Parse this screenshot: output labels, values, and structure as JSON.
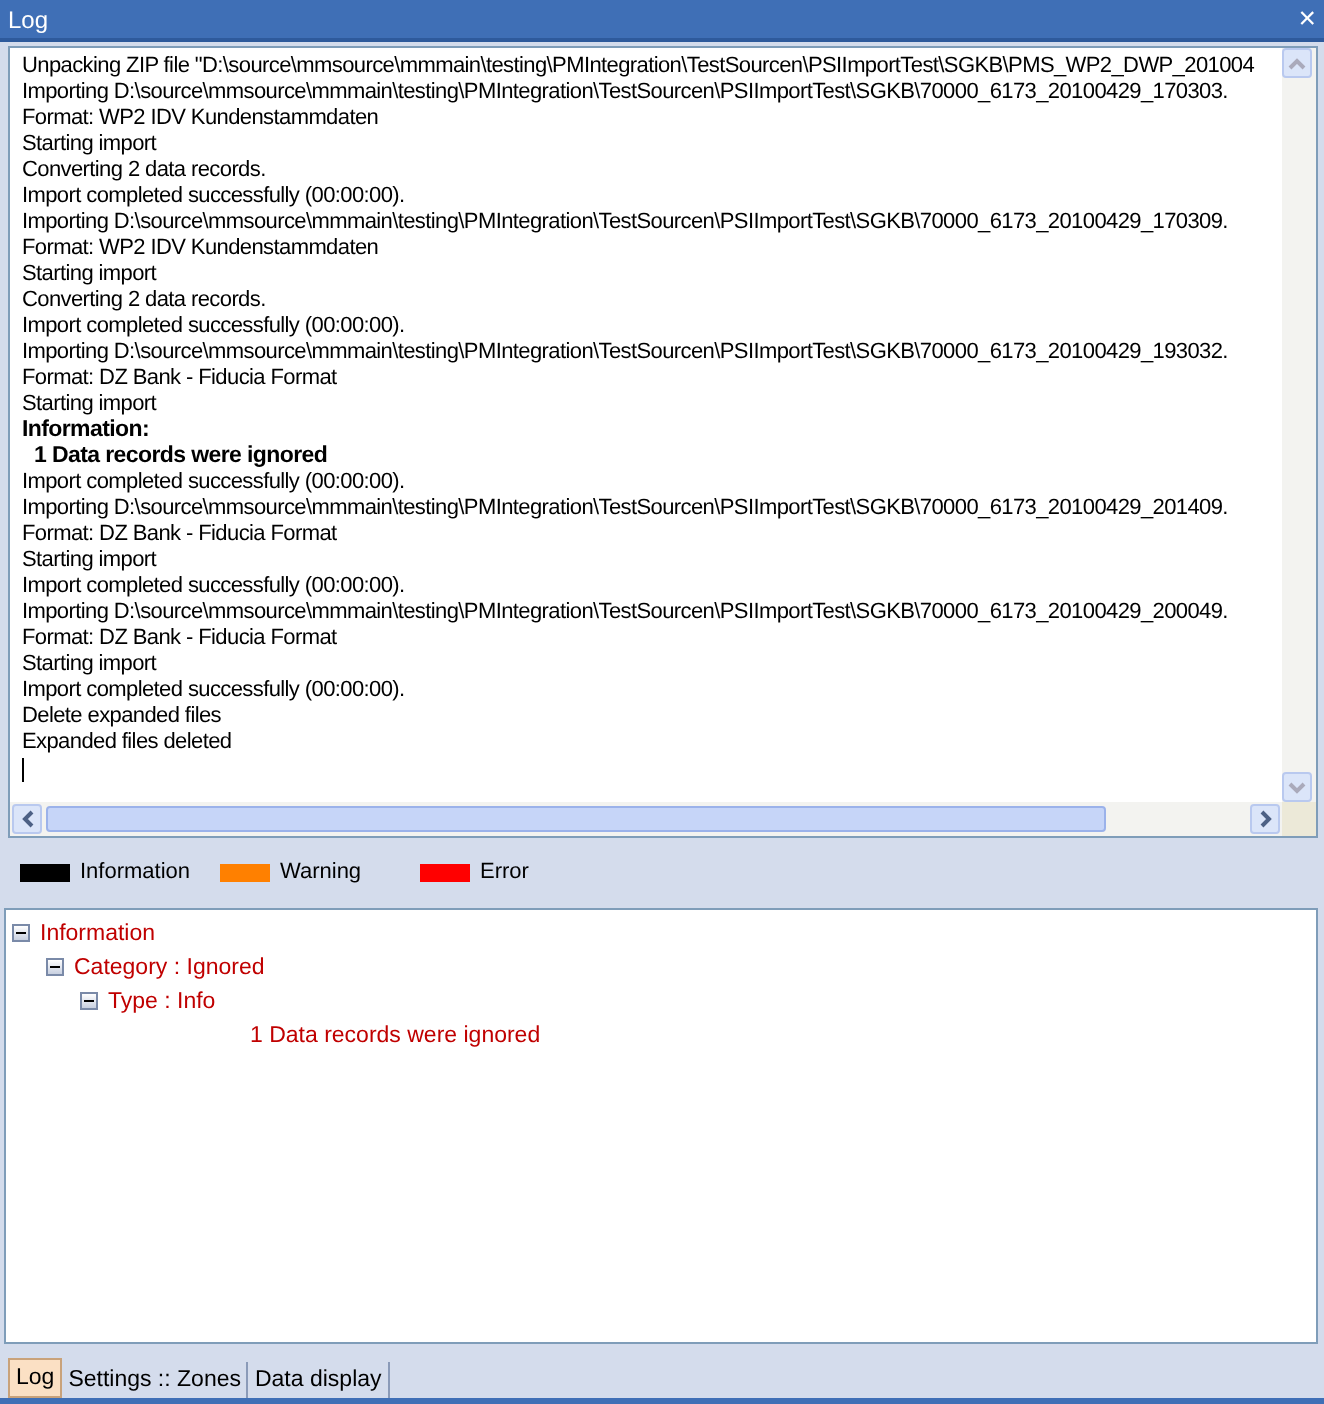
{
  "window": {
    "title": "Log",
    "close": "×"
  },
  "log": {
    "lines": [
      {
        "kind": "plain",
        "text": "Unpacking ZIP file \"D:\\source\\mmsource\\mmmain\\testing\\PMIntegration\\TestSourcen\\PSIImportTest\\SGKB\\PMS_WP2_DWP_201004"
      },
      {
        "kind": "plain",
        "text": "Importing D:\\source\\mmsource\\mmmain\\testing\\PMIntegration\\TestSourcen\\PSIImportTest\\SGKB\\70000_6173_20100429_170303."
      },
      {
        "kind": "plain",
        "text": "Format: WP2 IDV Kundenstammdaten"
      },
      {
        "kind": "plain",
        "text": "Starting import"
      },
      {
        "kind": "plain",
        "text": "Converting 2 data records."
      },
      {
        "kind": "plain",
        "text": "Import completed successfully (00:00:00)."
      },
      {
        "kind": "plain",
        "text": "Importing D:\\source\\mmsource\\mmmain\\testing\\PMIntegration\\TestSourcen\\PSIImportTest\\SGKB\\70000_6173_20100429_170309."
      },
      {
        "kind": "plain",
        "text": "Format: WP2 IDV Kundenstammdaten"
      },
      {
        "kind": "plain",
        "text": "Starting import"
      },
      {
        "kind": "plain",
        "text": "Converting 2 data records."
      },
      {
        "kind": "plain",
        "text": "Import completed successfully (00:00:00)."
      },
      {
        "kind": "plain",
        "text": "Importing D:\\source\\mmsource\\mmmain\\testing\\PMIntegration\\TestSourcen\\PSIImportTest\\SGKB\\70000_6173_20100429_193032."
      },
      {
        "kind": "plain",
        "text": "Format: DZ Bank - Fiducia Format"
      },
      {
        "kind": "plain",
        "text": "Starting import"
      },
      {
        "kind": "bold",
        "text": "Information:"
      },
      {
        "kind": "bold-indented",
        "text": "1 Data records were ignored"
      },
      {
        "kind": "plain",
        "text": "Import completed successfully (00:00:00)."
      },
      {
        "kind": "plain",
        "text": "Importing D:\\source\\mmsource\\mmmain\\testing\\PMIntegration\\TestSourcen\\PSIImportTest\\SGKB\\70000_6173_20100429_201409."
      },
      {
        "kind": "plain",
        "text": "Format: DZ Bank - Fiducia Format"
      },
      {
        "kind": "plain",
        "text": "Starting import"
      },
      {
        "kind": "plain",
        "text": "Import completed successfully (00:00:00)."
      },
      {
        "kind": "plain",
        "text": "Importing D:\\source\\mmsource\\mmmain\\testing\\PMIntegration\\TestSourcen\\PSIImportTest\\SGKB\\70000_6173_20100429_200049."
      },
      {
        "kind": "plain",
        "text": "Format: DZ Bank - Fiducia Format"
      },
      {
        "kind": "plain",
        "text": "Starting import"
      },
      {
        "kind": "plain",
        "text": "Import completed successfully (00:00:00)."
      },
      {
        "kind": "plain",
        "text": "Delete expanded files"
      },
      {
        "kind": "plain",
        "text": "Expanded files deleted"
      }
    ]
  },
  "legend": [
    {
      "label": "Information",
      "color": "#000000"
    },
    {
      "label": "Warning",
      "color": "#ff8000"
    },
    {
      "label": "Error",
      "color": "#ff0000"
    }
  ],
  "tree": [
    {
      "label": "Information",
      "expanded": true,
      "children": [
        {
          "label": "Category : Ignored",
          "expanded": true,
          "children": [
            {
              "label": "Type : Info",
              "expanded": true,
              "children": [
                {
                  "label": "1 Data records were ignored"
                }
              ]
            }
          ]
        }
      ]
    }
  ],
  "tabs": [
    {
      "label": "Log",
      "selected": true
    },
    {
      "label": "Settings :: Zones",
      "selected": false
    },
    {
      "label": "Data display",
      "selected": false
    }
  ]
}
